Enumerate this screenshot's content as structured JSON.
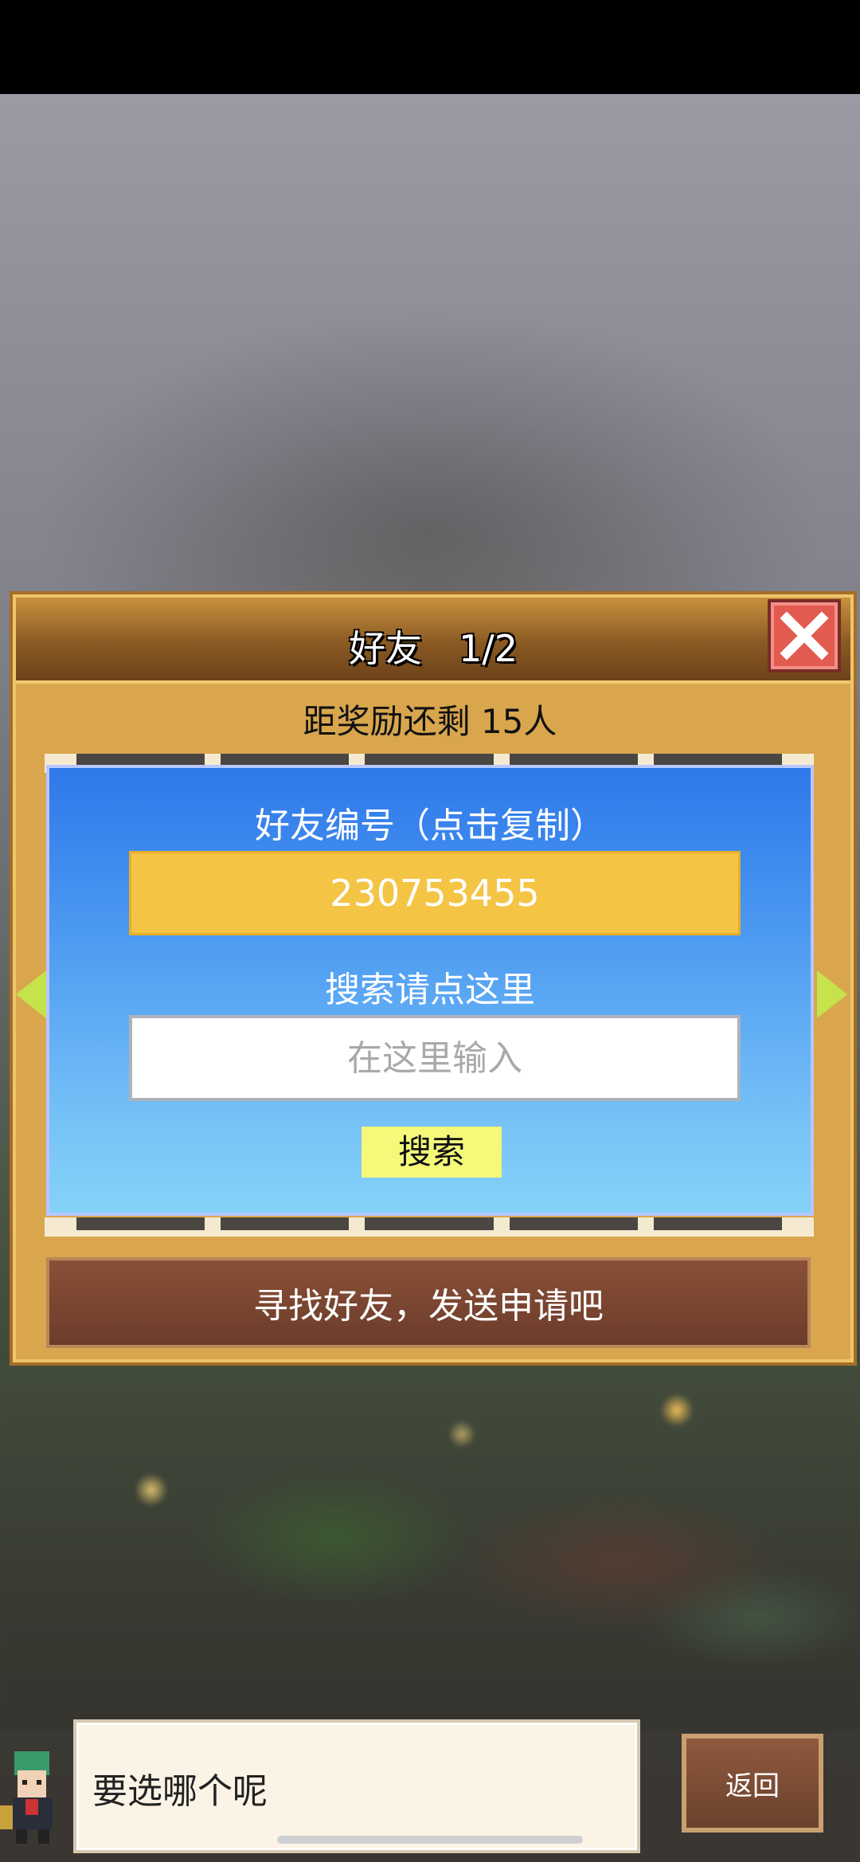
{
  "dialog": {
    "title": "好友　1/2",
    "reward_text": "距奖励还剩 15人",
    "friend_id_label": "好友编号（点击复制）",
    "friend_id_value": "230753455",
    "search_label": "搜索请点这里",
    "search_placeholder": "在这里输入",
    "search_button": "搜索",
    "find_friends_button": "寻找好友，发送申请吧"
  },
  "bottom": {
    "speech_text": "要选哪个呢",
    "back_button": "返回"
  },
  "colors": {
    "dialog_bg": "#d9a64e",
    "panel_blue": "#2e78ea",
    "id_box": "#f4c445",
    "search_button": "#f5f97a",
    "close_red": "#e35a50",
    "nav_arrow": "#c5e34a"
  },
  "icons": {
    "close": "close-icon",
    "left": "arrow-left-icon",
    "right": "arrow-right-icon"
  }
}
